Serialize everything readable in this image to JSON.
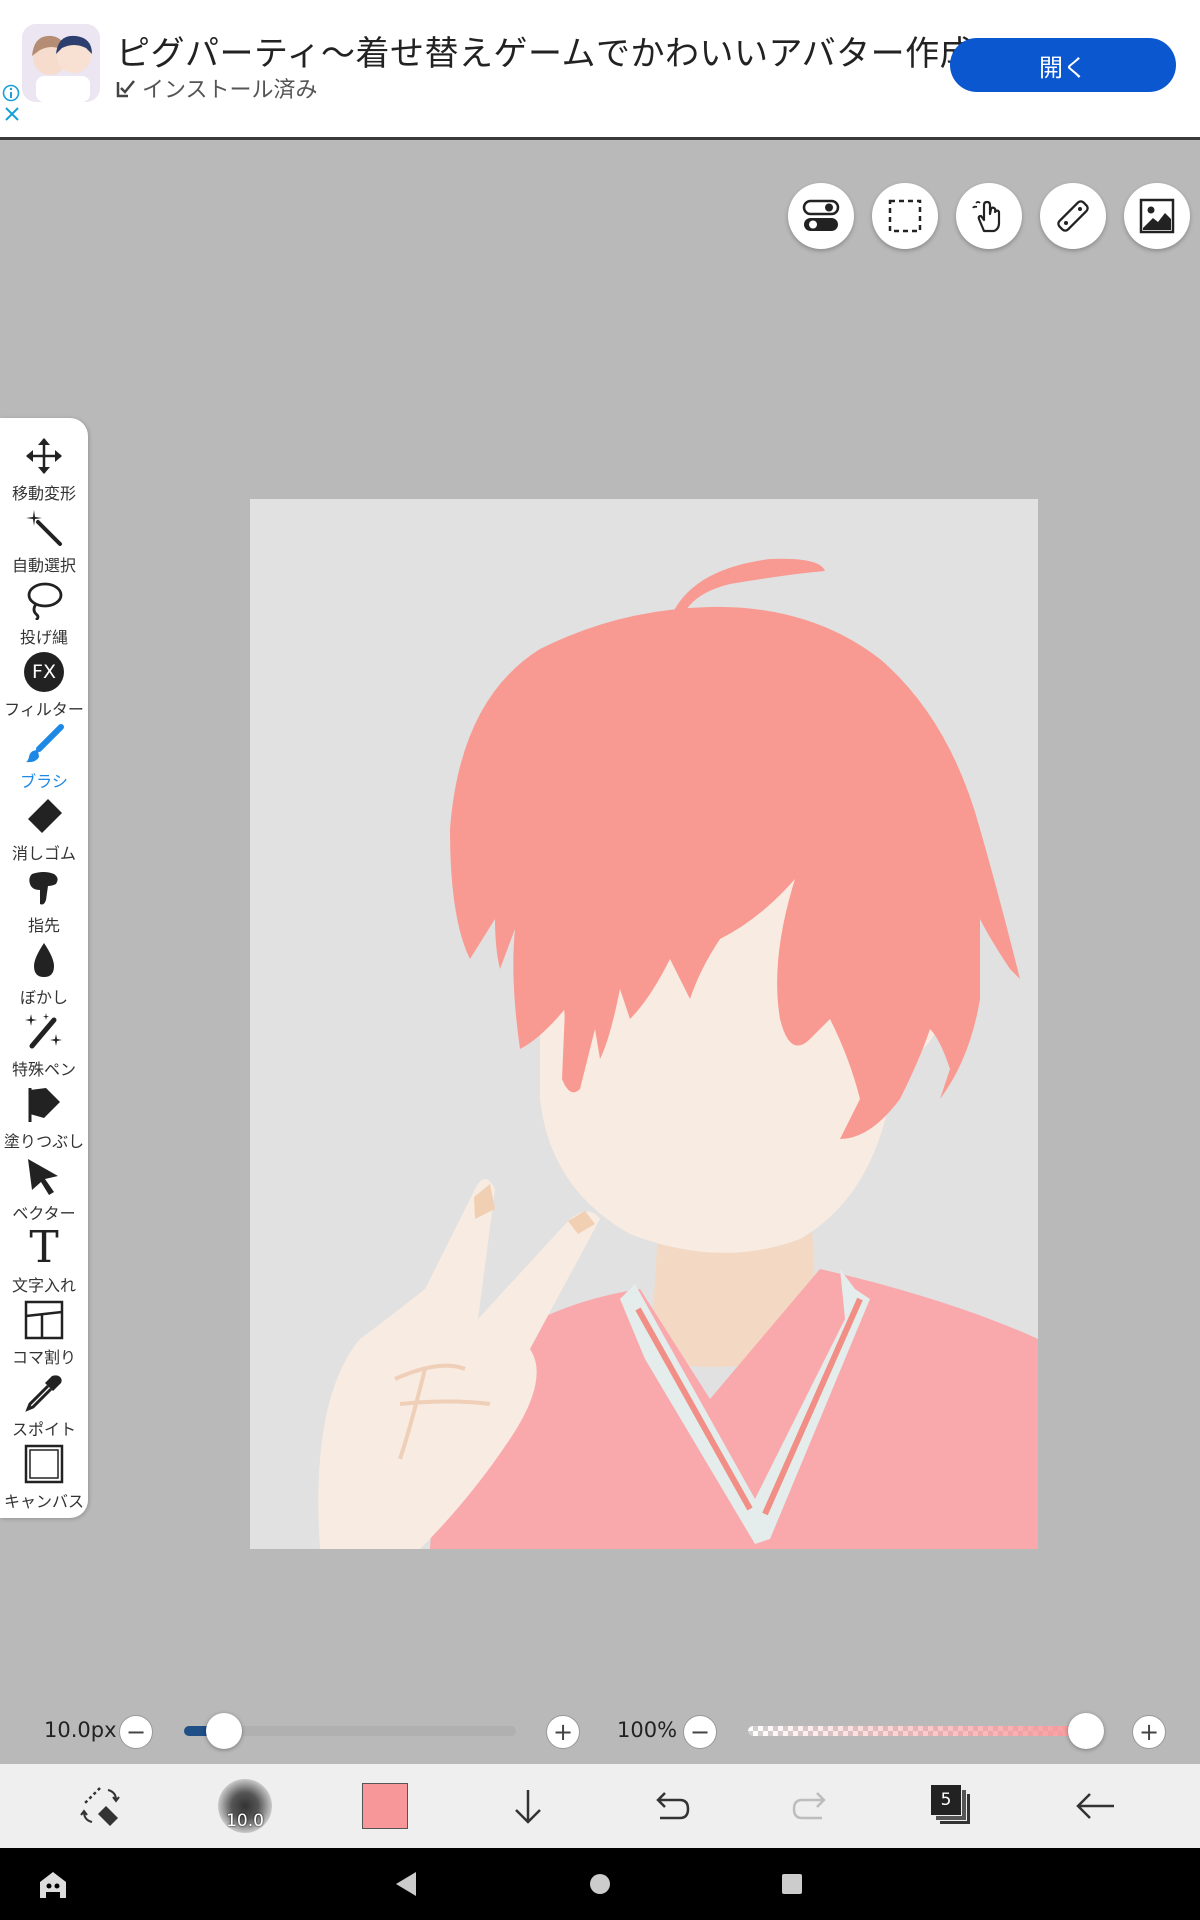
{
  "ad": {
    "title": "ピグパーティ〜着せ替えゲームでかわいいアバター作成",
    "installed_label": "インストール済み",
    "open_label": "開く"
  },
  "top_tools": [
    "toggle-icon",
    "selection-icon",
    "hand-icon",
    "ruler-icon",
    "image-icon"
  ],
  "toolbar": {
    "items": [
      {
        "label": "移動変形",
        "icon": "move-icon"
      },
      {
        "label": "自動選択",
        "icon": "magic-wand-icon"
      },
      {
        "label": "投げ縄",
        "icon": "lasso-icon"
      },
      {
        "label": "フィルター",
        "icon": "fx-icon",
        "icon_text": "FX"
      },
      {
        "label": "ブラシ",
        "icon": "brush-icon",
        "active": true
      },
      {
        "label": "消しゴム",
        "icon": "eraser-icon"
      },
      {
        "label": "指先",
        "icon": "finger-icon"
      },
      {
        "label": "ぼかし",
        "icon": "blur-icon"
      },
      {
        "label": "特殊ペン",
        "icon": "special-pen-icon"
      },
      {
        "label": "塗りつぶし",
        "icon": "fill-icon"
      },
      {
        "label": "ベクター",
        "icon": "vector-icon"
      },
      {
        "label": "文字入れ",
        "icon": "text-icon",
        "icon_text": "T"
      },
      {
        "label": "コマ割り",
        "icon": "frame-icon"
      },
      {
        "label": "スポイト",
        "icon": "eyedropper-icon"
      },
      {
        "label": "キャンバス",
        "icon": "canvas-icon"
      }
    ]
  },
  "brush": {
    "size_label": "10.0px",
    "size_fraction": 0.12,
    "opacity_label": "100%",
    "opacity_fraction": 1.0,
    "preview_value": "10.0"
  },
  "colors": {
    "current": "#f7979a",
    "accent": "#1e88e5",
    "ad_button": "#0b57d0"
  },
  "bottom_bar": {
    "layers_count": "5"
  }
}
